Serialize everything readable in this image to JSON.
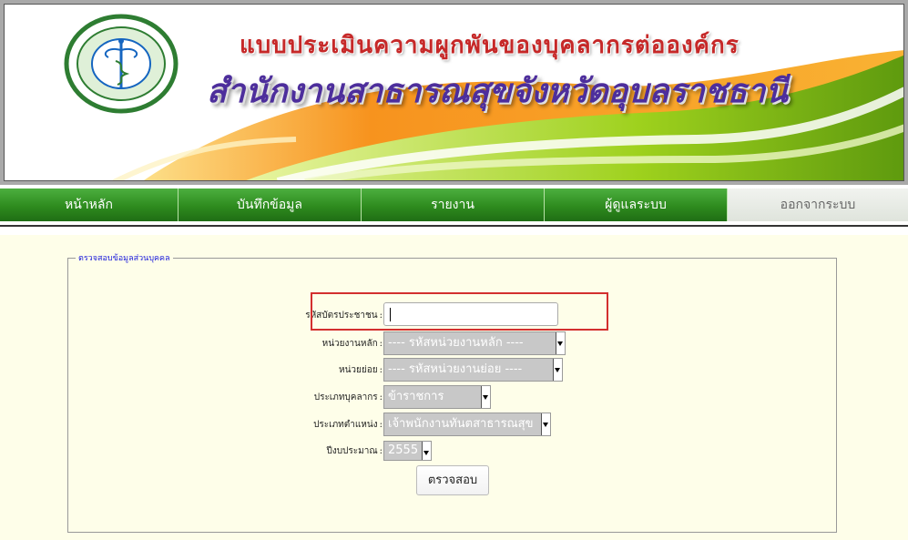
{
  "banner": {
    "title_line1": "แบบประเมินความผูกพันของบุคลากรต่อองค์กร",
    "title_line2": "สำนักงานสาธารณสุขจังหวัดอุบลราชธานี",
    "logo_icon": "caduceus-seal-icon",
    "colors": {
      "title1": "#c62828",
      "title2": "#4d2e9c",
      "orange": "#f7931e",
      "green": "#7cc11e"
    }
  },
  "nav": {
    "items": [
      {
        "label": "หน้าหลัก"
      },
      {
        "label": "บันทึกข้อมูล"
      },
      {
        "label": "รายงาน"
      },
      {
        "label": "ผู้ดูแลระบบ"
      },
      {
        "label": "ออกจากระบบ"
      }
    ]
  },
  "form": {
    "legend": "ตรวจสอบข้อมูลส่วนบุคคล",
    "fields": {
      "citizen_id": {
        "label": "รหัสบัตรประชาชน",
        "value": ""
      },
      "main_unit": {
        "label": "หน่วยงานหลัก",
        "selected": "---- รหัสหน่วยงานหลัก ----"
      },
      "sub_unit": {
        "label": "หน่วยย่อย",
        "selected": "---- รหัสหน่วยงานย่อย ----"
      },
      "personnel_type": {
        "label": "ประเภทบุคลากร",
        "selected": "ข้าราชการ"
      },
      "position_type": {
        "label": "ประเภทตำแหน่ง",
        "selected": "เจ้าพนักงานทันตสาธารณสุข"
      },
      "fiscal_year": {
        "label": "ปีงบประมาณ",
        "selected": "2555"
      }
    },
    "colon": ":",
    "submit_label": "ตรวจสอบ"
  }
}
